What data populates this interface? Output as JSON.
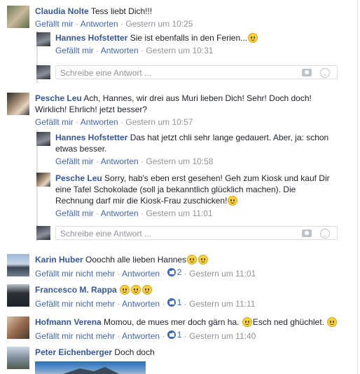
{
  "labels": {
    "like": "Gefällt mir",
    "unlike": "Gefällt mir nicht mehr",
    "reply": "Antworten",
    "separator": "·",
    "reply_placeholder": "Schreibe eine Antwort ..."
  },
  "comments": [
    {
      "author": "Claudia Nolte",
      "text": "Tess liebt Dich!!!",
      "timestamp": "Gestern um 10:25",
      "liked": false,
      "replies": [
        {
          "author": "Hannes Hofstetter",
          "text": "Sie ist ebenfalls in den Ferien...",
          "emoji": "flushed-emoji",
          "timestamp": "Gestern um 10:31"
        }
      ]
    },
    {
      "author": "Pesche Leu",
      "text": "Ach, Hannes, wir drei aus Muri lieben Dich! Sehr! Doch doch! Wirklich! Ehrlich! jetzt besser?",
      "timestamp": "Gestern um 10:57",
      "liked": false,
      "replies": [
        {
          "author": "Hannes Hofstetter",
          "text": "Das hat jetzt chli sehr lange gedauert. Aber, ja: schon etwas besser.",
          "timestamp": "Gestern um 10:58"
        },
        {
          "author": "Pesche Leu",
          "text": "Sorry, hab's eben erst gesehen! Geh zum Kiosk und kauf Dir eine Tafel Schokolade (soll ja bekanntlich glücklich machen). Die Rechnung darf mir die Kiosk-Frau zuschicken!",
          "emoji": "smile-emoji",
          "timestamp": "Gestern um 11:01"
        }
      ]
    },
    {
      "author": "Karin Huber",
      "text": "Ooochh alle lieben Hannes",
      "emoji": "laughing-emoji, wink-emoji",
      "timestamp": "Gestern um 11:01",
      "liked": true,
      "like_count": "2"
    },
    {
      "author": "Francesco M. Rappa",
      "text": "",
      "emoji": "smile-emoji x3",
      "timestamp": "Gestern um 11:11",
      "liked": true,
      "like_count": "1"
    },
    {
      "author": "Hofmann Verena",
      "text": "Momou, de mues mer doch gärn ha.",
      "text2": "Esch ned ghüchlet.",
      "emoji": "kiss-emoji, laughing-emoji",
      "timestamp": "Gestern um 11:40",
      "liked": true,
      "like_count": "1"
    },
    {
      "author": "Peter Eichenberger",
      "text": "Doch doch"
    }
  ],
  "colors": {
    "author": "#365899",
    "link": "#4267b2",
    "meta": "#90949c",
    "border": "#dddfe2"
  }
}
